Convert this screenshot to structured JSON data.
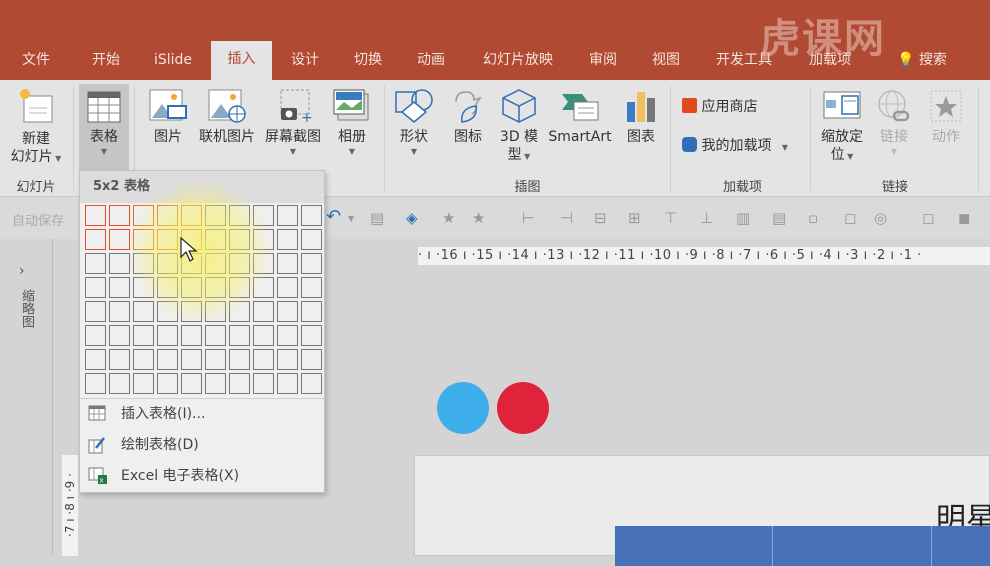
{
  "tabs": [
    {
      "label": "文件",
      "active": false
    },
    {
      "label": "开始",
      "active": false
    },
    {
      "label": "iSlide",
      "active": false
    },
    {
      "label": "插入",
      "active": true
    },
    {
      "label": "设计",
      "active": false
    },
    {
      "label": "切换",
      "active": false
    },
    {
      "label": "动画",
      "active": false
    },
    {
      "label": "幻灯片放映",
      "active": false
    },
    {
      "label": "审阅",
      "active": false
    },
    {
      "label": "视图",
      "active": false
    },
    {
      "label": "开发工具",
      "active": false
    },
    {
      "label": "加载项",
      "active": false
    }
  ],
  "search_label": "搜索",
  "watermark": "虎课网",
  "ribbon": {
    "new_slide": {
      "line1": "新建",
      "line2": "幻灯片"
    },
    "table": "表格",
    "picture": "图片",
    "online_picture": "联机图片",
    "screenshot": "屏幕截图",
    "album": "相册",
    "shapes": "形状",
    "icons": "图标",
    "model3d": {
      "line1": "3D 模",
      "line2": "型"
    },
    "smartart": "SmartArt",
    "chart": "图表",
    "app_store": "应用商店",
    "my_addins": "我的加载项",
    "zoom": {
      "line1": "缩放定",
      "line2": "位"
    },
    "link": "链接",
    "action": "动作",
    "groups": {
      "slides": "幻灯片",
      "illustrations": "插图",
      "addins": "加载项",
      "links": "链接"
    }
  },
  "qat": {
    "autosave": "自动保存"
  },
  "ruler_h": "· ı ·16 ı ·15 ı ·14 ı ·13 ı ·12 ı ·11 ı ·10 ı ·9 ı ·8 ı ·7 ı ·6 ı ·5 ı ·4 ı ·3 ı ·2 ı ·1 ·",
  "ruler_v": "·7 ı ·8 ı ·9 ·",
  "sidepane": {
    "label": "缩略图"
  },
  "table_dropdown": {
    "header": "5x2 表格",
    "grid_cols": 10,
    "grid_rows": 8,
    "selected_cols": 5,
    "selected_rows": 2,
    "items": [
      {
        "label": "插入表格(I)..."
      },
      {
        "label": "绘制表格(D)"
      },
      {
        "label": "Excel 电子表格(X)"
      }
    ]
  },
  "slide": {
    "title": "明星"
  },
  "colors": {
    "accent": "#b04a33",
    "circle_blue": "#3daeea",
    "circle_red": "#e0223a",
    "table_header": "#4770b8",
    "highlight": "#e07524"
  }
}
